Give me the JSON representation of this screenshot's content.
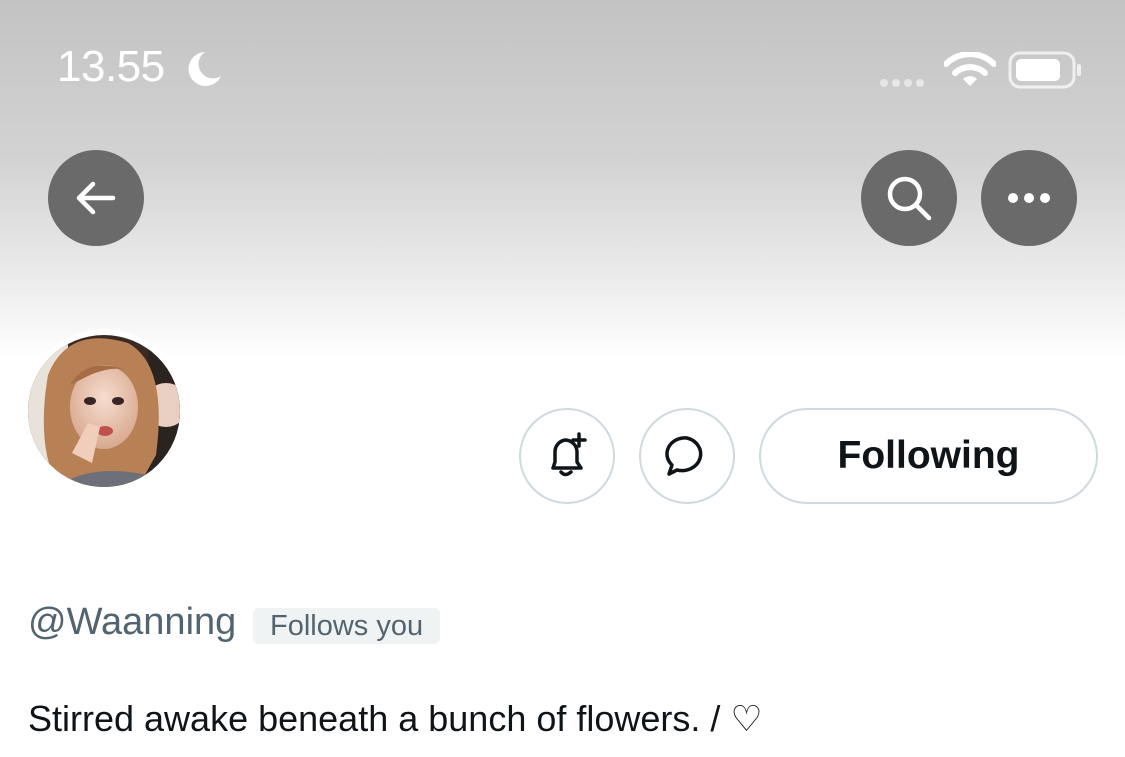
{
  "status_bar": {
    "time": "13.55",
    "icons": [
      "moon-icon",
      "signal-dots-icon",
      "wifi-icon",
      "battery-icon"
    ]
  },
  "nav": {
    "back_icon": "arrow-left-icon",
    "search_icon": "search-icon",
    "more_icon": "more-horizontal-icon"
  },
  "profile": {
    "handle": "@Waanning",
    "follows_you": "Follows you",
    "bio": "Stirred awake beneath a bunch of flowers. / ♡"
  },
  "actions": {
    "notify_icon": "bell-plus-icon",
    "message_icon": "message-bubble-icon",
    "following_label": "Following"
  },
  "colors": {
    "header_top": "#c3c3c3",
    "nav_button": "#6a6a6a",
    "outline": "#cfd9de",
    "text_primary": "#0f1419",
    "text_secondary": "#536471",
    "badge_bg": "#eff3f4"
  }
}
